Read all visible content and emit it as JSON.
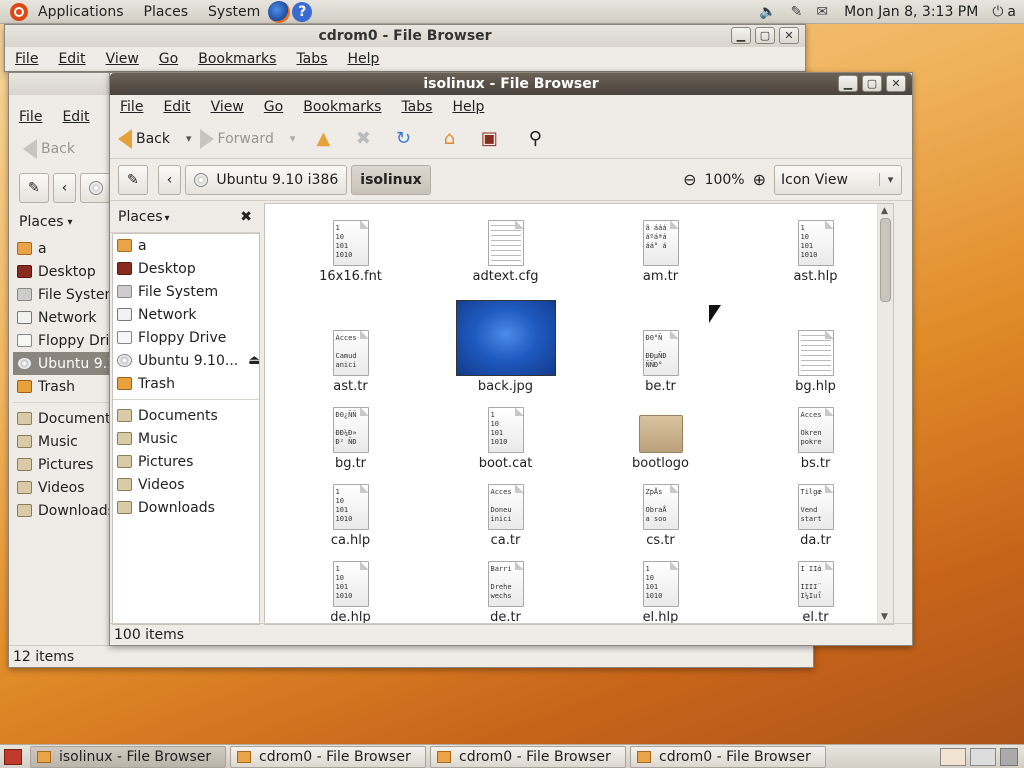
{
  "top_panel": {
    "applications": "Applications",
    "places": "Places",
    "system": "System",
    "clock": "Mon Jan  8,  3:13 PM",
    "user": "a"
  },
  "back_window_top": {
    "title": "cdrom0 - File Browser",
    "menus": [
      "File",
      "Edit",
      "View",
      "Go",
      "Bookmarks",
      "Tabs",
      "Help"
    ]
  },
  "back_window_left": {
    "menus": [
      "File",
      "Edit",
      "V"
    ],
    "back_label": "Back",
    "places_label": "Places",
    "places": [
      "a",
      "Desktop",
      "File System",
      "Network",
      "Floppy Driv",
      "Ubuntu 9.10",
      "Trash",
      "Documents",
      "Music",
      "Pictures",
      "Videos",
      "Downloads"
    ],
    "status": "12 items"
  },
  "main_window": {
    "title": "isolinux - File Browser",
    "menus": [
      "File",
      "Edit",
      "View",
      "Go",
      "Bookmarks",
      "Tabs",
      "Help"
    ],
    "toolbar": {
      "back": "Back",
      "forward": "Forward"
    },
    "location": {
      "crumb1": "Ubuntu 9.10 i386",
      "crumb2": "isolinux",
      "zoom": "100%",
      "view_mode": "Icon View"
    },
    "sidebar": {
      "header": "Places",
      "items": [
        "a",
        "Desktop",
        "File System",
        "Network",
        "Floppy Drive",
        "Ubuntu 9.10...",
        "Trash"
      ],
      "bookmarks": [
        "Documents",
        "Music",
        "Pictures",
        "Videos",
        "Downloads"
      ]
    },
    "files": [
      {
        "name": "16x16.fnt",
        "preview": "1\n10\n101\n1010"
      },
      {
        "name": "adtext.cfg",
        "preview": ""
      },
      {
        "name": "am.tr",
        "preview": "ã ááá\náºáªá\náá° á"
      },
      {
        "name": "ast.hlp",
        "preview": "1\n10\n101\n1010"
      },
      {
        "name": "ast.tr",
        "preview": "Acces\n\nCamud\nanici"
      },
      {
        "name": "back.jpg",
        "preview": ""
      },
      {
        "name": "be.tr",
        "preview": "Ð0°Ñ\n\nÐÐµÑÐ\nÑÑÐ°"
      },
      {
        "name": "bg.hlp",
        "preview": ""
      },
      {
        "name": "bg.tr",
        "preview": "Ð0¿ÑÑ\n\nÐÐ¼Ð»\nÐ² ÑÐ"
      },
      {
        "name": "boot.cat",
        "preview": "1\n10\n101\n1010"
      },
      {
        "name": "bootlogo",
        "preview": ""
      },
      {
        "name": "bs.tr",
        "preview": "Acces\n\nOkren\npokre"
      },
      {
        "name": "ca.hlp",
        "preview": "1\n10\n101\n1010"
      },
      {
        "name": "ca.tr",
        "preview": "Acces\n\nDoneu\ninici"
      },
      {
        "name": "cs.tr",
        "preview": "ZpÅ­s\n\nObraÅ\na soo"
      },
      {
        "name": "da.tr",
        "preview": "Tilgæ\n\nVend\nstart"
      },
      {
        "name": "de.hlp",
        "preview": "1\n10\n101\n1010"
      },
      {
        "name": "de.tr",
        "preview": "Barri\n\nDrehe\nwechs"
      },
      {
        "name": "el.hlp",
        "preview": "1\n10\n101\n1010"
      },
      {
        "name": "el.tr",
        "preview": "Ι ΙΙά\n\nΙΙΙΙ¨\nΙ¼Ιuΐ"
      }
    ],
    "status": "100 items"
  },
  "taskbar": {
    "tasks": [
      "isolinux - File Browser",
      "cdrom0 - File Browser",
      "cdrom0 - File Browser",
      "cdrom0 - File Browser"
    ]
  }
}
